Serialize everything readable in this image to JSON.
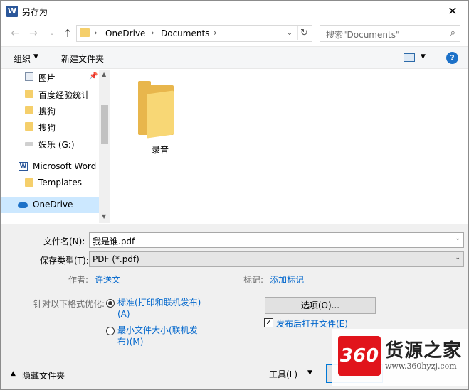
{
  "window": {
    "title": "另存为",
    "app_icon": "W",
    "close_glyph": "✕"
  },
  "address": {
    "segments": [
      "OneDrive",
      "Documents"
    ],
    "search_placeholder": "搜索\"Documents\""
  },
  "toolbar": {
    "organize_label": "组织",
    "new_folder_label": "新建文件夹",
    "help_glyph": "?"
  },
  "nav_pane": {
    "items": [
      {
        "label": "图片",
        "icon": "picture-icon"
      },
      {
        "label": "百度经验统计",
        "icon": "folder-icon"
      },
      {
        "label": "搜狗",
        "icon": "folder-icon"
      },
      {
        "label": "搜狗",
        "icon": "folder-icon"
      },
      {
        "label": "娱乐 (G:)",
        "icon": "drive-icon"
      },
      {
        "label": "Microsoft Word",
        "icon": "word-icon"
      },
      {
        "label": "Templates",
        "icon": "folder-icon"
      },
      {
        "label": "OneDrive",
        "icon": "cloud-icon",
        "selected": true
      }
    ]
  },
  "content": {
    "folders": [
      {
        "name": "录音"
      }
    ]
  },
  "form": {
    "filename_label": "文件名(N):",
    "filename_value": "我是谁.pdf",
    "filetype_label": "保存类型(T):",
    "filetype_value": "PDF (*.pdf)",
    "author_label": "作者:",
    "author_value": "许送文",
    "tags_label": "标记:",
    "tags_value": "添加标记",
    "optimize_label": "针对以下格式优化:",
    "radio_standard_line1": "标准(打印和联机发布)",
    "radio_standard_line2": "(A)",
    "radio_min_line1": "最小文件大小(联机发",
    "radio_min_line2": "布)(M)",
    "options_button": "选项(O)...",
    "open_after_publish": "发布后打开文件(E)",
    "hide_folders": "隐藏文件夹",
    "tools_label": "工具(L)"
  },
  "watermark": {
    "logo_text": "360",
    "name": "货源之家",
    "url": "www.360hyzj.com"
  },
  "colors": {
    "accent": "#0066cc",
    "selected_bg": "#cce8ff",
    "folder": "#f5cf6b",
    "watermark_red": "#e1141b"
  }
}
